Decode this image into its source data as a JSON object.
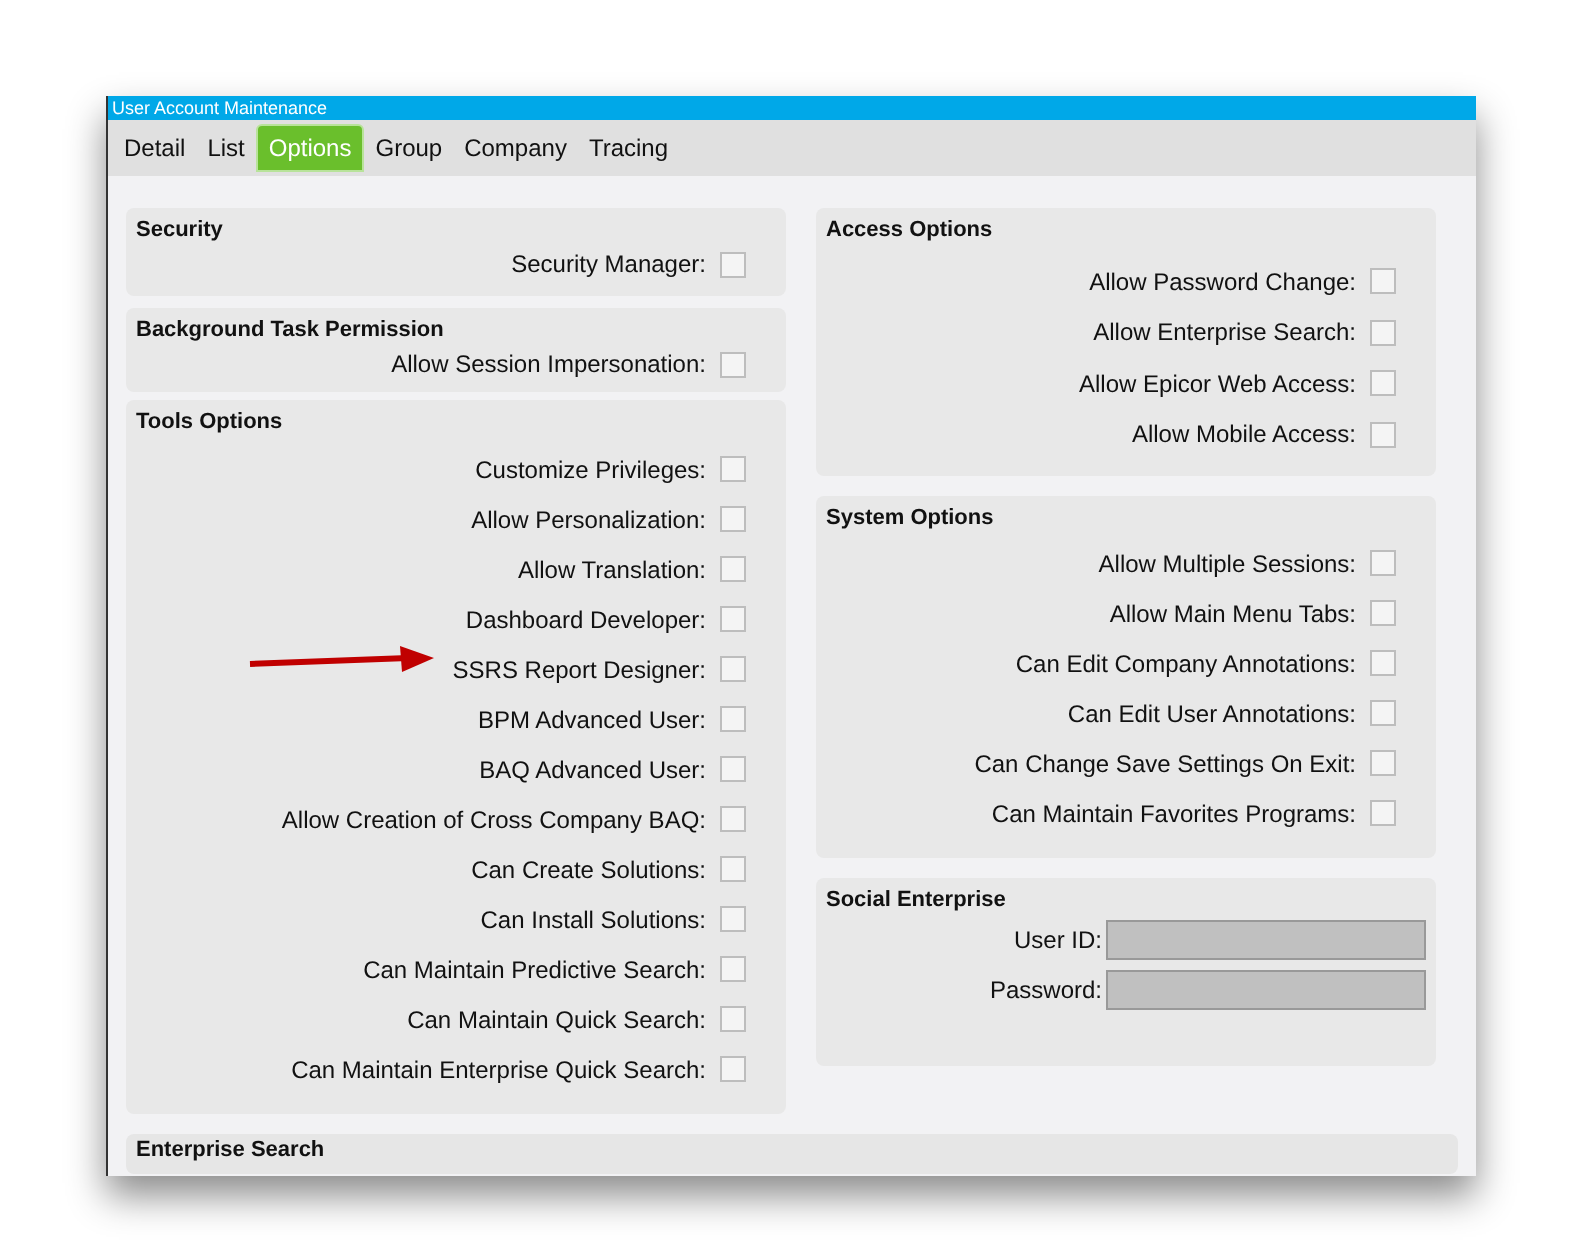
{
  "window": {
    "title": "User Account Maintenance"
  },
  "tabs": [
    {
      "label": "Detail",
      "selected": false
    },
    {
      "label": "List",
      "selected": false
    },
    {
      "label": "Options",
      "selected": true
    },
    {
      "label": "Group",
      "selected": false
    },
    {
      "label": "Company",
      "selected": false
    },
    {
      "label": "Tracing",
      "selected": false
    }
  ],
  "left_sections": [
    {
      "title": "Security",
      "items": [
        {
          "label": "Security Manager:",
          "checked": false
        }
      ]
    },
    {
      "title": "Background Task Permission",
      "items": [
        {
          "label": "Allow Session Impersonation:",
          "checked": false
        }
      ]
    },
    {
      "title": "Tools Options",
      "items": [
        {
          "label": "Customize Privileges:",
          "checked": false
        },
        {
          "label": "Allow Personalization:",
          "checked": false
        },
        {
          "label": "Allow Translation:",
          "checked": false
        },
        {
          "label": "Dashboard Developer:",
          "checked": false
        },
        {
          "label": "SSRS Report Designer:",
          "checked": false
        },
        {
          "label": "BPM Advanced User:",
          "checked": false
        },
        {
          "label": "BAQ Advanced User:",
          "checked": false
        },
        {
          "label": "Allow Creation of Cross Company BAQ:",
          "checked": false
        },
        {
          "label": "Can Create Solutions:",
          "checked": false
        },
        {
          "label": "Can Install Solutions:",
          "checked": false
        },
        {
          "label": "Can Maintain Predictive Search:",
          "checked": false
        },
        {
          "label": "Can Maintain Quick Search:",
          "checked": false
        },
        {
          "label": "Can Maintain Enterprise Quick Search:",
          "checked": false
        }
      ]
    }
  ],
  "right_sections": [
    {
      "title": "Access Options",
      "items": [
        {
          "label": "Allow Password Change:",
          "checked": false
        },
        {
          "label": "Allow Enterprise Search:",
          "checked": false
        },
        {
          "label": "Allow Epicor Web Access:",
          "checked": false
        },
        {
          "label": "Allow Mobile Access:",
          "checked": false
        }
      ]
    },
    {
      "title": "System Options",
      "items": [
        {
          "label": "Allow Multiple Sessions:",
          "checked": false
        },
        {
          "label": "Allow Main Menu Tabs:",
          "checked": false
        },
        {
          "label": "Can Edit Company Annotations:",
          "checked": false
        },
        {
          "label": "Can Edit User Annotations:",
          "checked": false
        },
        {
          "label": "Can Change Save Settings On Exit:",
          "checked": false
        },
        {
          "label": "Can Maintain Favorites Programs:",
          "checked": false
        }
      ]
    }
  ],
  "social_enterprise": {
    "title": "Social Enterprise",
    "fields": [
      {
        "label": "User ID:"
      },
      {
        "label": "Password:"
      }
    ]
  },
  "bottom_section": {
    "title": "Enterprise Search"
  }
}
